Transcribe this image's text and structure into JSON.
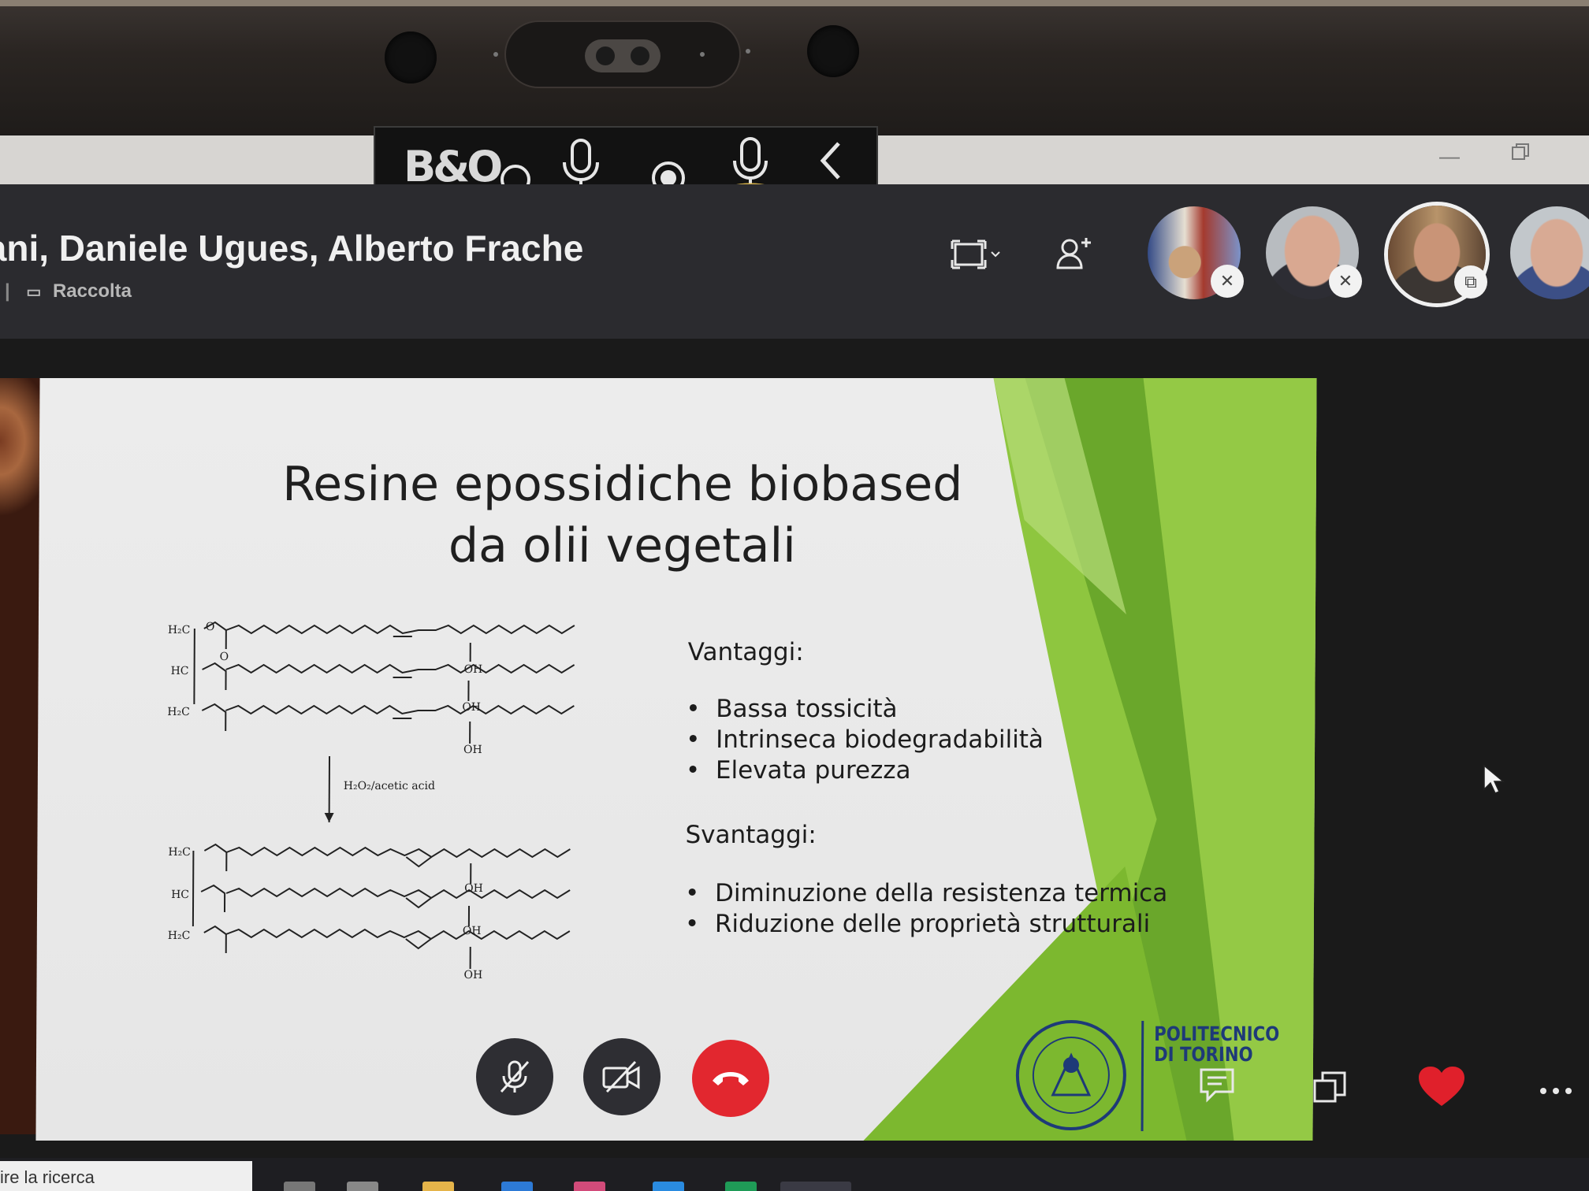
{
  "meeting": {
    "title": "iani, Daniele Ugues, Alberto Frache",
    "subtitle": "Raccolta"
  },
  "slide": {
    "title_line1": "Resine epossidiche biobased",
    "title_line2": "da olii vegetali",
    "pros_title": "Vantaggi:",
    "pros": [
      "Bassa tossicità",
      "Intrinseca biodegradabilità",
      "Elevata purezza"
    ],
    "cons_title": "Svantaggi:",
    "cons": [
      "Diminuzione della resistenza termica",
      "Riduzione delle proprietà strutturali"
    ],
    "reaction_condition": "H₂O₂/acetic acid",
    "chem_labels": {
      "h2c": "H₂C",
      "hc": "HC",
      "oh": "OH",
      "o": "O"
    },
    "logo_line1": "POLITECNICO",
    "logo_line2": "DI TORINO"
  },
  "taskbar": {
    "search_placeholder": "ire la ricerca"
  },
  "colors": {
    "end_call": "#e2272f",
    "heart": "#e0202b",
    "header_bg": "#2b2b2f",
    "slide_green": "#7cb82f"
  },
  "icons": {
    "bo_logo": "B&O",
    "toolbar": [
      "circle-icon",
      "microphone-icon",
      "record-icon",
      "microphone-waves-icon",
      "chevron-left-icon"
    ],
    "header": [
      "screen-share-icon",
      "add-person-icon"
    ],
    "controls": [
      "mic-off-icon",
      "video-off-icon",
      "hang-up-icon"
    ],
    "side": [
      "chat-icon",
      "popout-icon",
      "heart-icon",
      "more-icon"
    ]
  }
}
